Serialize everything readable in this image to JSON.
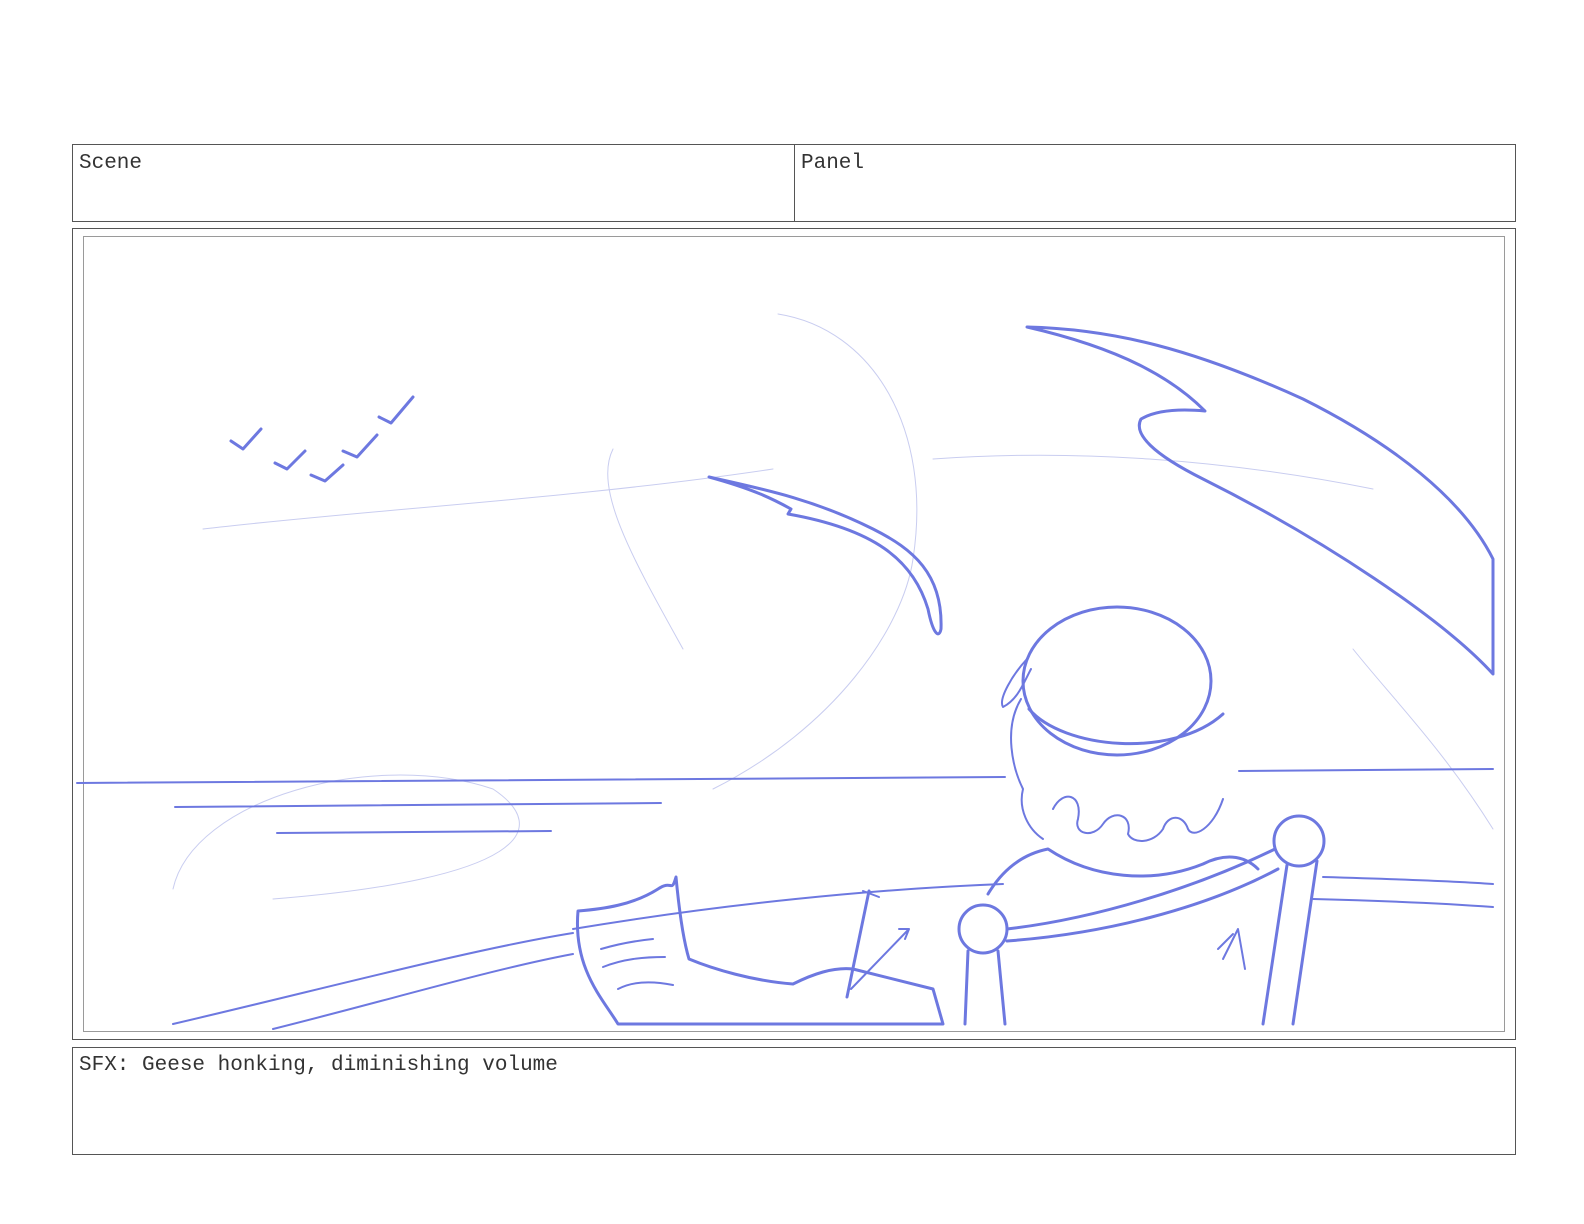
{
  "header": {
    "scene_label": "Scene",
    "panel_label": "Panel"
  },
  "notes": {
    "text": "SFX: Geese honking, diminishing volume"
  },
  "colors": {
    "sketch_line": "#6d78e0",
    "border": "#555555"
  }
}
